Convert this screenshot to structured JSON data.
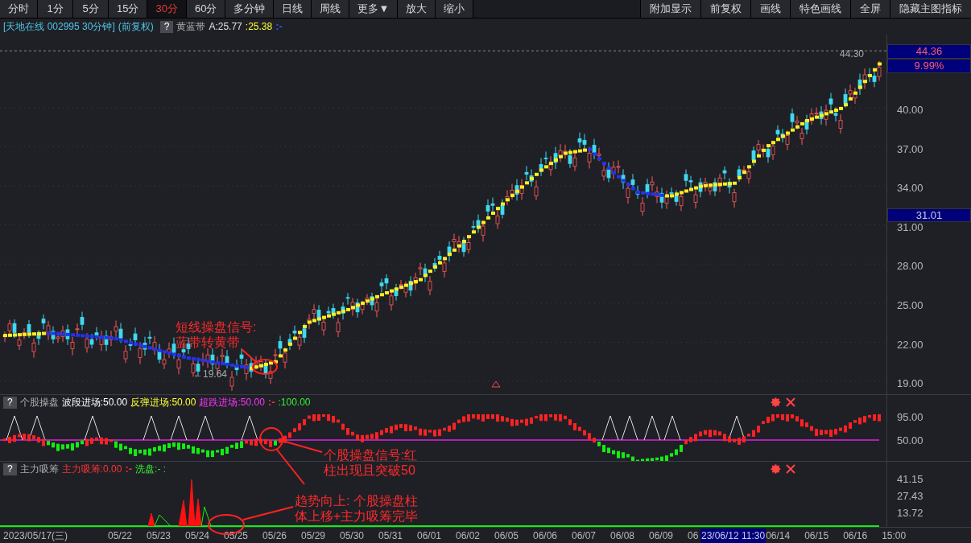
{
  "toolbar": {
    "periods": [
      {
        "label": "分时",
        "selected": false
      },
      {
        "label": "1分",
        "selected": false
      },
      {
        "label": "5分",
        "selected": false
      },
      {
        "label": "15分",
        "selected": false
      },
      {
        "label": "30分",
        "selected": true
      },
      {
        "label": "60分",
        "selected": false
      },
      {
        "label": "多分钟",
        "selected": false
      },
      {
        "label": "日线",
        "selected": false
      },
      {
        "label": "周线",
        "selected": false
      },
      {
        "label": "更多▼",
        "selected": false
      },
      {
        "label": "放大",
        "selected": false
      },
      {
        "label": "缩小",
        "selected": false
      }
    ],
    "actions": [
      "附加显示",
      "前复权",
      "画线",
      "特色画线",
      "全屏",
      "隐藏主图指标"
    ]
  },
  "main_chart": {
    "title": "[天地在线 002995 30分钟]",
    "adjust": "(前复权)",
    "help": "?",
    "indicator": "黄蓝带",
    "values": [
      {
        "text": "A:25.77",
        "color": "#e0e0e0"
      },
      {
        "text": ":25.38",
        "color": "#ffff33"
      },
      {
        "text": ":-",
        "color": "#3355ff"
      }
    ],
    "high_label": "44.30",
    "low_label": "←19.64",
    "last_price": "44.36",
    "change": "9.99%",
    "cursor_price": "31.01",
    "axis": [
      "40.00",
      "37.00",
      "34.00",
      "31.00",
      "28.00",
      "25.00",
      "22.00",
      "19.00"
    ]
  },
  "panel_1": {
    "help": "?",
    "name": "个股操盘",
    "values": [
      {
        "text": "波段进场:50.00",
        "color": "#ffffff"
      },
      {
        "text": "反弹进场:50.00",
        "color": "#ffff33"
      },
      {
        "text": "超跌进场:50.00",
        "color": "#ff33ff"
      },
      {
        "text": ":-",
        "color": "#ff3333"
      },
      {
        "text": ":100.00",
        "color": "#33ee33"
      }
    ],
    "axis": [
      "95.00",
      "50.00"
    ]
  },
  "panel_2": {
    "help": "?",
    "name": "主力吸筹",
    "values": [
      {
        "text": "主力吸筹:0.00",
        "color": "#ff3333"
      },
      {
        "text": ":-",
        "color": "#ff3333"
      },
      {
        "text": "洗盘:- :",
        "color": "#33ee33"
      }
    ],
    "axis": [
      "41.15",
      "27.43",
      "13.72"
    ]
  },
  "x_axis": {
    "labels": [
      "2023/05/17(三)",
      "05/22",
      "05/23",
      "05/24",
      "05/25",
      "05/26",
      "05/29",
      "05/30",
      "05/31",
      "06/01",
      "06/02",
      "06/05",
      "06/06",
      "06/07",
      "06/08",
      "06/09",
      "06"
    ],
    "cursor_time": "23/06/12 11:30",
    "labels_after": [
      "06/14",
      "06/15",
      "06/16",
      "15:00"
    ]
  },
  "annotations": [
    {
      "lines": [
        "短线操盘信号:",
        "蓝带转黄带"
      ]
    },
    {
      "lines": [
        "个股操盘信号:红",
        "柱出现且突破50"
      ]
    },
    {
      "lines": [
        "趋势向上: 个股操盘柱",
        "体上移+主力吸筹完毕"
      ]
    }
  ]
}
